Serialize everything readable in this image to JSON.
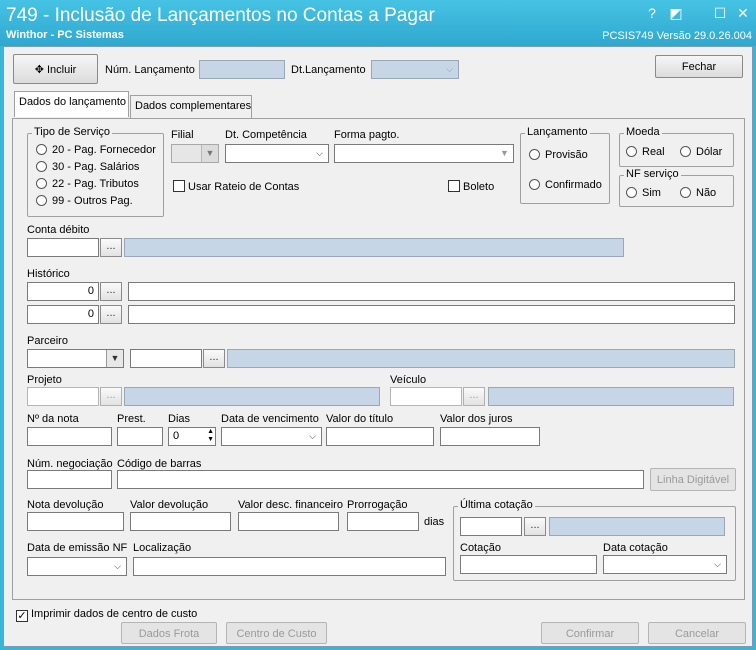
{
  "window": {
    "title": "749 - Inclusão de Lançamentos no Contas a Pagar",
    "subtitle": "Winthor - PC Sistemas",
    "version": "PCSIS749  Versão  29.0.26.004",
    "help_glyph": "?",
    "restore_glyph": "◩",
    "maximize_glyph": "☐",
    "close_glyph": "✕"
  },
  "toolbar": {
    "include_icon": "✥",
    "include_label": "Incluir",
    "num_lancamento_label": "Núm. Lançamento",
    "num_lancamento_value": "",
    "dt_lancamento_label": "Dt.Lançamento",
    "dt_lancamento_value": "",
    "close_label": "Fechar"
  },
  "tabs": [
    {
      "label": "Dados do lançamento",
      "active": true
    },
    {
      "label": "Dados complementares",
      "active": false
    }
  ],
  "tipo_servico": {
    "title": "Tipo de Serviço",
    "options": [
      "20 - Pag. Fornecedor",
      "30 - Pag. Salários",
      "22 - Pag. Tributos",
      "99 - Outros Pag."
    ]
  },
  "filial": {
    "label": "Filial",
    "value": ""
  },
  "dt_competencia": {
    "label": "Dt. Competência",
    "value": ""
  },
  "forma_pagto": {
    "label": "Forma pagto.",
    "value": ""
  },
  "lancamento": {
    "title": "Lançamento",
    "options": [
      "Provisão",
      "Confirmado"
    ]
  },
  "moeda": {
    "title": "Moeda",
    "options": [
      "Real",
      "Dólar"
    ]
  },
  "nf_servico": {
    "title": "NF serviço",
    "options": [
      "Sim",
      "Não"
    ]
  },
  "usar_rateio": {
    "label": "Usar Rateio de Contas",
    "checked": false
  },
  "boleto": {
    "label": "Boleto",
    "checked": false
  },
  "conta_debito": {
    "label": "Conta débito",
    "code": "",
    "description": ""
  },
  "historico": {
    "label": "Histórico",
    "code1": "0",
    "text1": "",
    "code2": "0",
    "text2": ""
  },
  "parceiro": {
    "label": "Parceiro",
    "type": "",
    "code": "",
    "description": ""
  },
  "projeto": {
    "label": "Projeto",
    "code": "",
    "description": ""
  },
  "veiculo": {
    "label": "Veículo",
    "code": "",
    "description": ""
  },
  "ellipsis": "...",
  "nota": {
    "num_nota_label": "Nº da nota",
    "num_nota_value": "",
    "prest_label": "Prest.",
    "prest_value": "",
    "dias_label": "Dias",
    "dias_value": "0",
    "vencimento_label": "Data de vencimento",
    "vencimento_value": "",
    "valor_titulo_label": "Valor do título",
    "valor_titulo_value": "",
    "valor_juros_label": "Valor dos juros",
    "valor_juros_value": ""
  },
  "negociacao": {
    "num_negociacao_label": "Núm. negociação",
    "num_negociacao_value": "",
    "codigo_barras_label": "Código de barras",
    "codigo_barras_value": "",
    "linha_digitavel_label": "Linha Digitável"
  },
  "devolucao": {
    "nota_devolucao_label": "Nota devolução",
    "nota_devolucao_value": "",
    "valor_devolucao_label": "Valor devolução",
    "valor_devolucao_value": "",
    "valor_desc_label": "Valor desc. financeiro",
    "valor_desc_value": "",
    "prorrogacao_label": "Prorrogação",
    "prorrogacao_value": "",
    "dias_suffix": "dias"
  },
  "emissao": {
    "data_emissao_label": "Data de emissão NF",
    "data_emissao_value": "",
    "localizacao_label": "Localização",
    "localizacao_value": ""
  },
  "ultima_cotacao": {
    "title": "Última cotação",
    "code": "",
    "description": "",
    "cotacao_label": "Cotação",
    "cotacao_value": "",
    "data_cotacao_label": "Data cotação",
    "data_cotacao_value": ""
  },
  "footer": {
    "imprimir_label": "Imprimir dados de centro de custo",
    "imprimir_checked": true,
    "check_glyph": "✓",
    "dados_frota_label": "Dados Frota",
    "centro_custo_label": "Centro de Custo",
    "confirmar_label": "Confirmar",
    "cancelar_label": "Cancelar"
  },
  "colors": {
    "titlebar": "#38b6d8",
    "disabled_field": "#c7d6e6"
  }
}
